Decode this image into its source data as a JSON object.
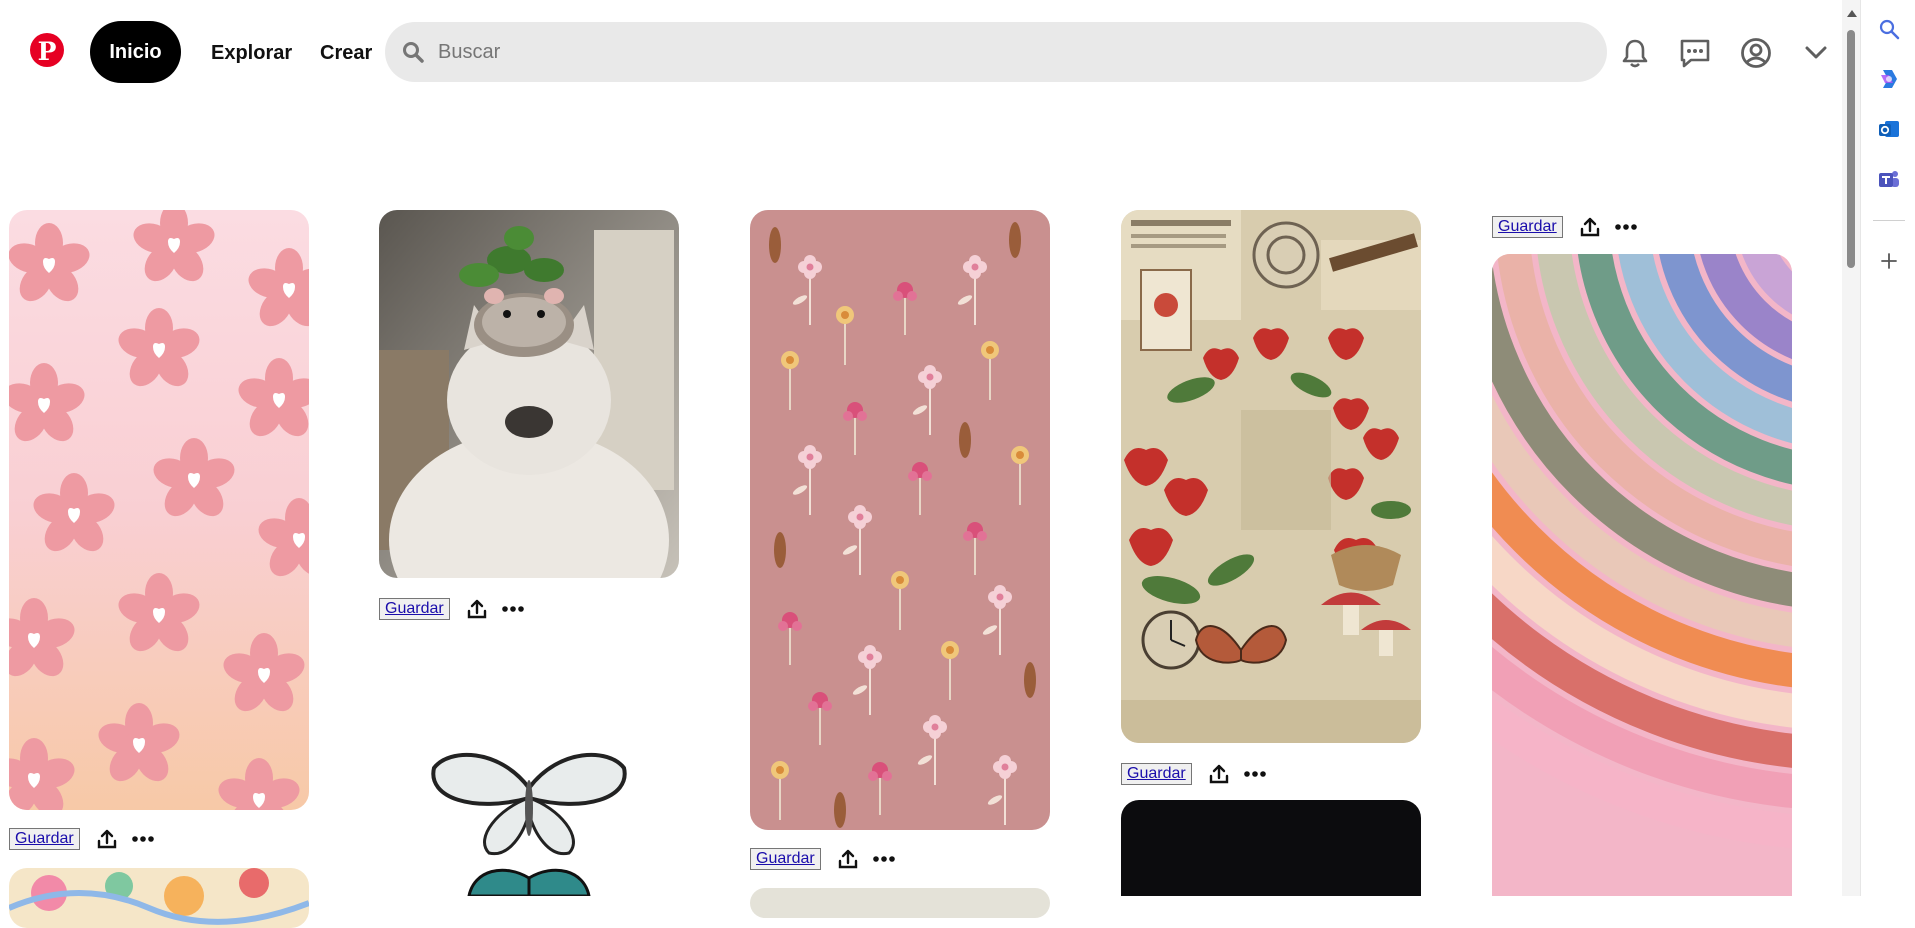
{
  "header": {
    "logo_letter": "P",
    "nav": {
      "home": "Inicio",
      "explore": "Explorar",
      "create": "Crear"
    },
    "search": {
      "placeholder": "Buscar",
      "value": ""
    },
    "icons": [
      "bell-icon",
      "messages-icon",
      "profile-icon",
      "chevron-down-icon"
    ]
  },
  "sidepanel": {
    "icons": [
      "search-icon",
      "copilot-icon",
      "outlook-icon",
      "teams-icon",
      "add-icon"
    ]
  },
  "pins": [
    {
      "save": "Guardar",
      "image": "pink-flowers-pattern"
    },
    {
      "save": "Guardar",
      "image": "cat-with-hamster"
    },
    {
      "save": "Guardar",
      "image": "floral-pattern-mauve"
    },
    {
      "save": "Guardar",
      "image": "strawberry-collage"
    },
    {
      "save": "Guardar",
      "image": "rainbow-swirl"
    }
  ],
  "colors": {
    "brand": "#e60023",
    "home_button": "#000000",
    "search_bg": "#e9e9e9"
  }
}
